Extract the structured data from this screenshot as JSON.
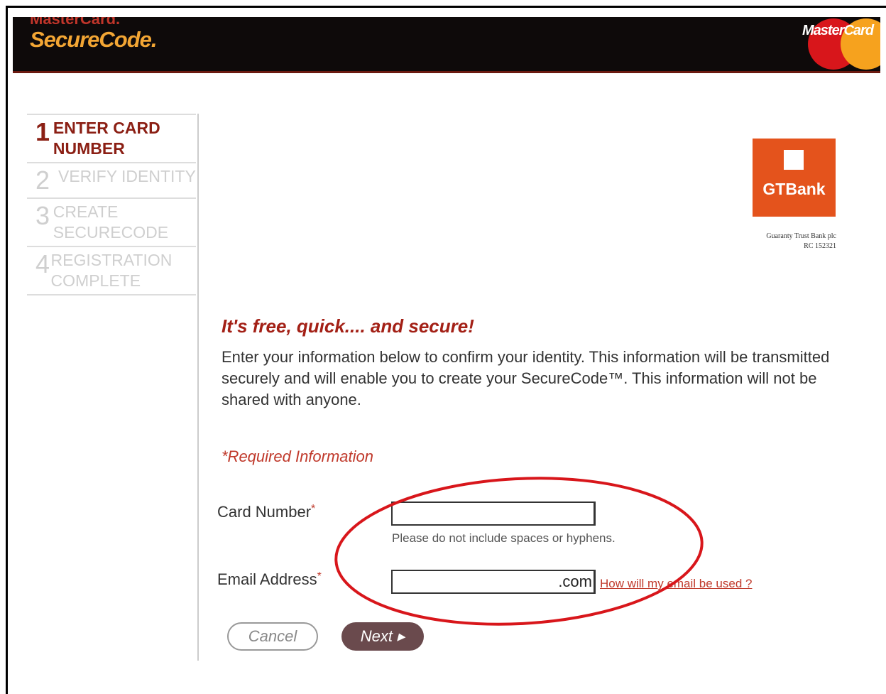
{
  "header": {
    "brand_top": "MasterCard.",
    "brand": "SecureCode",
    "brand_dot": ".",
    "logo_text": "MasterCard"
  },
  "steps": [
    {
      "num": "1",
      "label": "ENTER CARD NUMBER",
      "state": "active"
    },
    {
      "num": "2",
      "label": "VERIFY IDENTITY",
      "state": "inactive"
    },
    {
      "num": "3",
      "label": "CREATE SECURECODE",
      "state": "inactive"
    },
    {
      "num": "4",
      "label": "REGISTRATION COMPLETE",
      "state": "inactive"
    }
  ],
  "bank": {
    "name": "GTBank",
    "subtitle": "Guaranty Trust Bank plc",
    "rc": "RC 152321"
  },
  "content": {
    "headline": "It's free, quick.... and secure!",
    "intro": "Enter your information below to confirm your identity. This information will be transmitted securely and will enable you to create your SecureCode™. This information will not be shared with anyone.",
    "required_note": "*Required Information"
  },
  "form": {
    "card_label": "Card Number",
    "card_value": "",
    "card_hint": "Please do not include spaces or hyphens.",
    "email_label": "Email Address",
    "email_value": ".com",
    "email_link": "How will my email be used ?",
    "required_mark": "*"
  },
  "buttons": {
    "cancel": "Cancel",
    "next": "Next ▸"
  },
  "colors": {
    "accent": "#a32016",
    "header_bg": "#0e0a0a",
    "gtbank_orange": "#e4531c",
    "annotation": "#d8161b"
  }
}
